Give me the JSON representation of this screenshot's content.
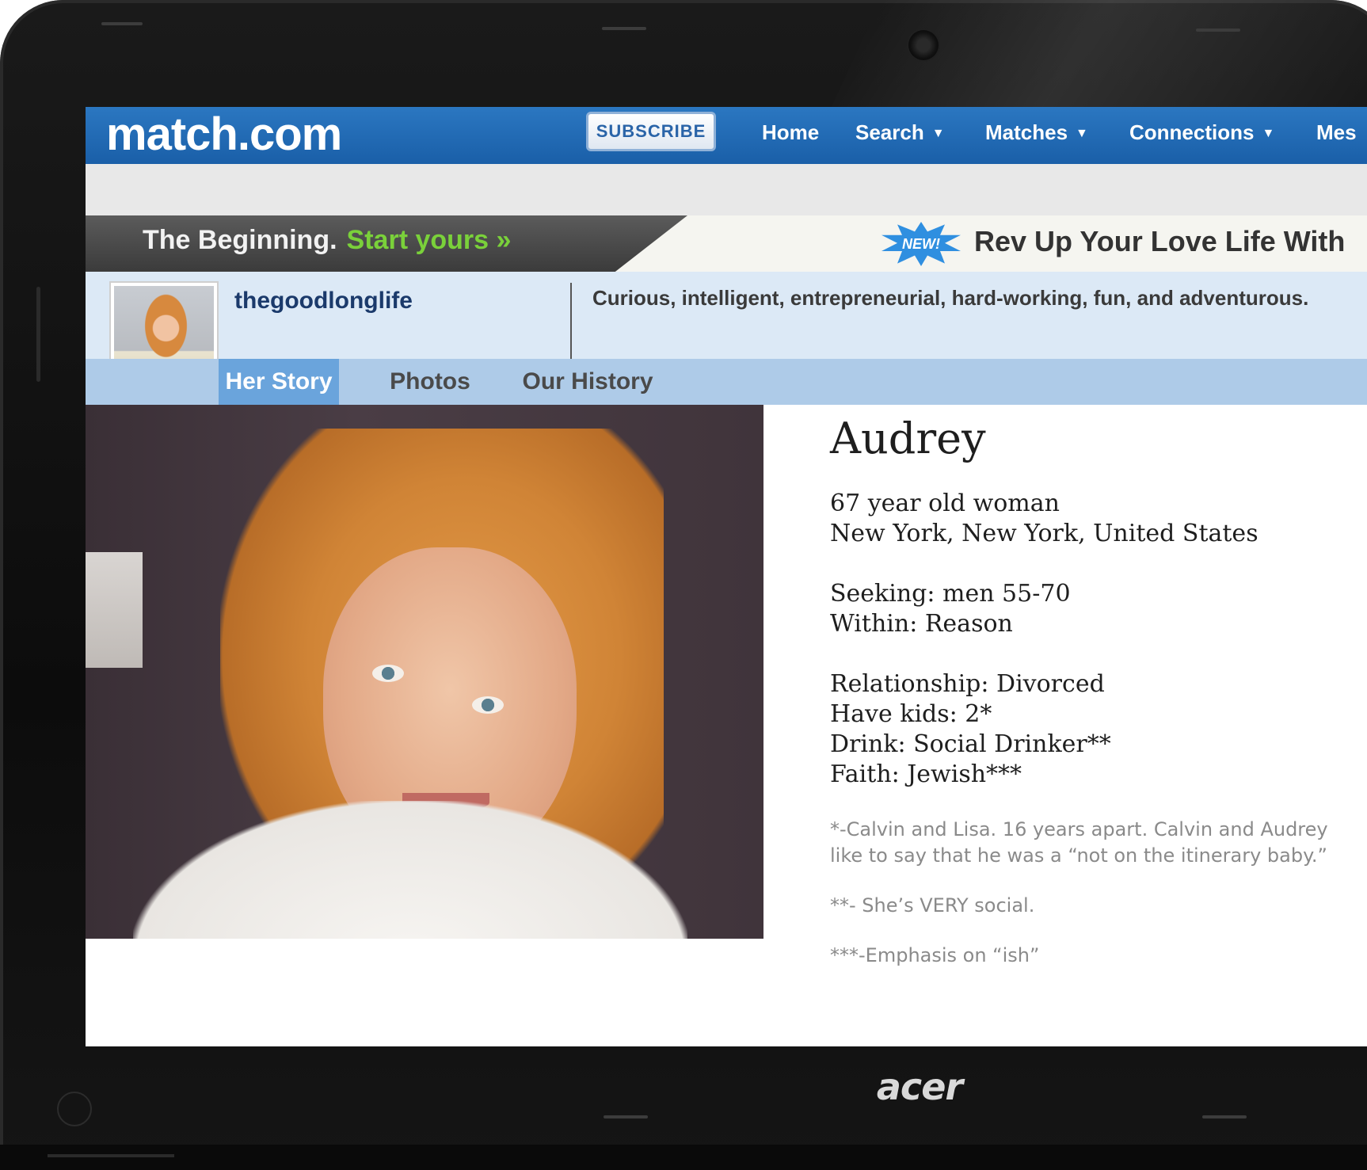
{
  "device": {
    "brand": "acer"
  },
  "site": {
    "logo": "match.com",
    "subscribe_label": "SUBSCRIBE",
    "nav": [
      {
        "label": "Home",
        "dropdown": false
      },
      {
        "label": "Search",
        "dropdown": true
      },
      {
        "label": "Matches",
        "dropdown": true
      },
      {
        "label": "Connections",
        "dropdown": true
      },
      {
        "label": "Mes",
        "dropdown": false
      }
    ],
    "colors": {
      "brand": "#1a5fa8",
      "accent_green": "#7ad13a",
      "tab_active": "#6aa4dc"
    }
  },
  "promo": {
    "left_text": "The Beginning.",
    "cta": "Start yours »",
    "badge": "NEW!",
    "right_text": "Rev Up Your Love Life With"
  },
  "profile": {
    "username": "thegoodlonglife",
    "tagline": "Curious, intelligent, entrepreneurial, hard-working, fun, and adventurous.",
    "tabs": [
      {
        "label": "Her Story",
        "active": true
      },
      {
        "label": "Photos",
        "active": false
      },
      {
        "label": "Our History",
        "active": false
      }
    ],
    "name": "Audrey",
    "details": {
      "age_gender": "67 year old woman",
      "location": "New York, New York, United States",
      "seeking": "Seeking: men 55-70",
      "within": "Within: Reason",
      "relationship": "Relationship: Divorced",
      "kids": "Have kids: 2*",
      "drink": "Drink: Social Drinker**",
      "faith": "Faith: Jewish***"
    },
    "footnotes": [
      "*-Calvin and Lisa. 16 years apart. Calvin and Audrey like to say that he was a “not on the itinerary baby.”",
      "**- She’s VERY social.",
      "***-Emphasis on “ish”"
    ]
  }
}
